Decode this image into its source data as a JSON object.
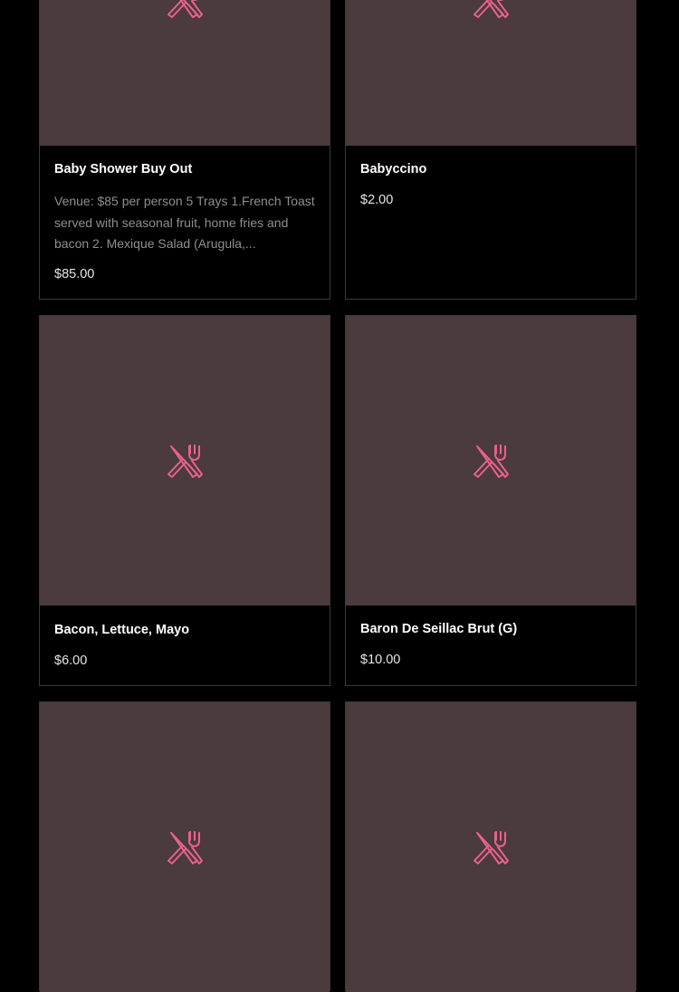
{
  "colors": {
    "background": "#000000",
    "image_placeholder": "#4b3a3e",
    "icon": "#e8628a",
    "card_border": "#3a3a3a",
    "description": "#8f8f8f"
  },
  "placeholder_icon": "fork-knife-icon",
  "items": [
    {
      "title": "Baby Shower Buy Out",
      "description": "Venue: $85 per person 5 Trays 1.French Toast served with seasonal fruit, home fries and bacon 2. Mexique Salad (Arugula,...",
      "price": "$85.00"
    },
    {
      "title": "Babyccino",
      "description": "",
      "price": "$2.00"
    },
    {
      "title": "Bacon, Lettuce, Mayo",
      "description": "",
      "price": "$6.00"
    },
    {
      "title": "Baron De Seillac Brut (G)",
      "description": "",
      "price": "$10.00"
    },
    {
      "title": "",
      "description": "",
      "price": ""
    },
    {
      "title": "",
      "description": "",
      "price": ""
    }
  ]
}
